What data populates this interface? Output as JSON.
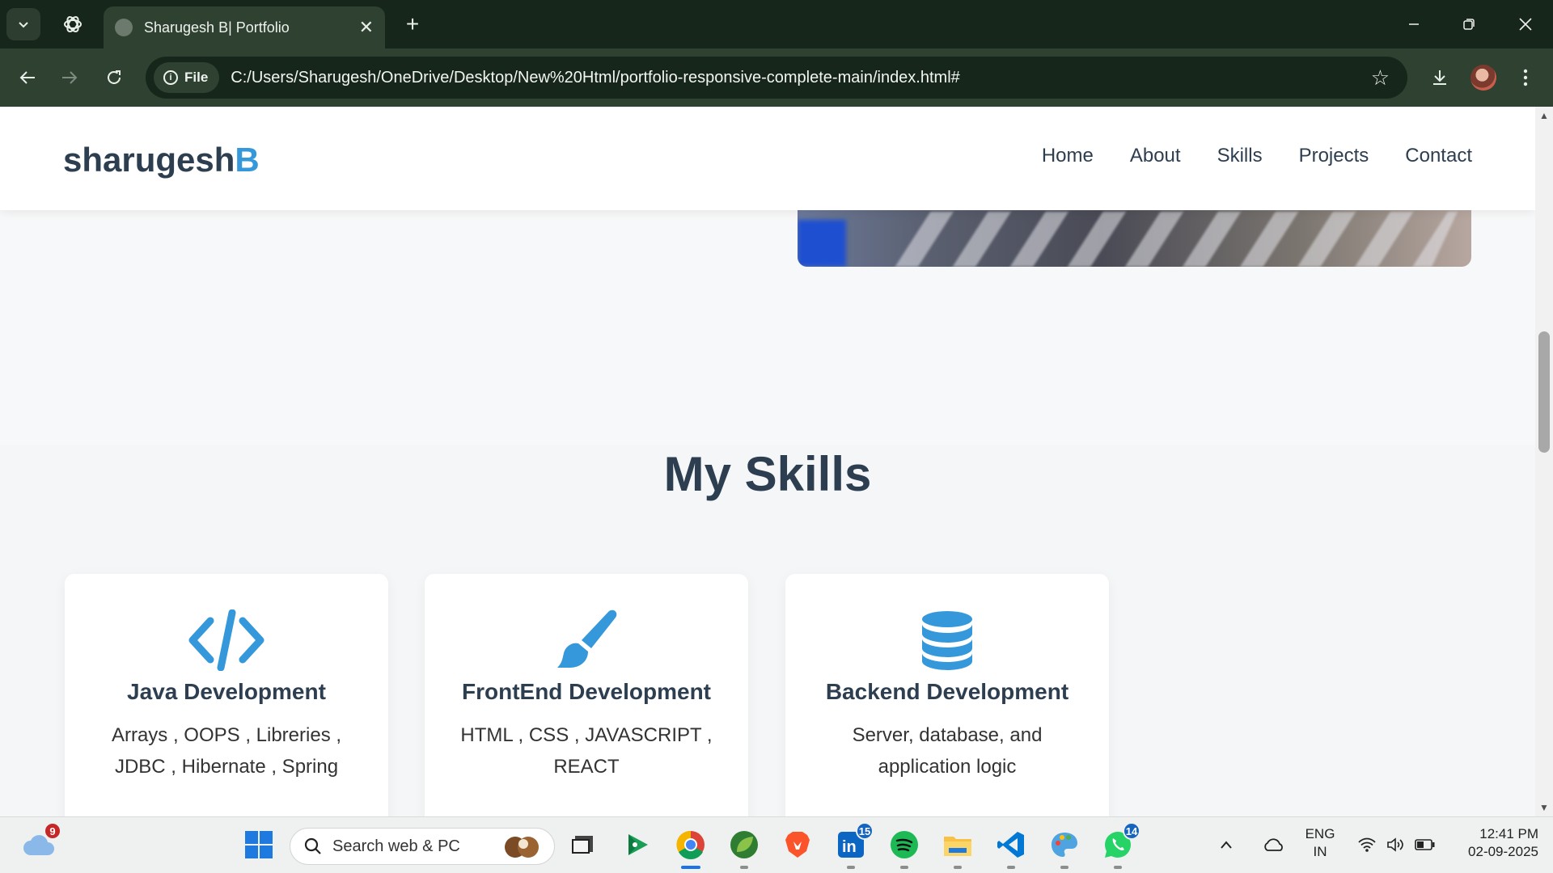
{
  "browser": {
    "tab_title": "Sharugesh B| Portfolio",
    "file_chip": "File",
    "url": "C:/Users/Sharugesh/OneDrive/Desktop/New%20Html/portfolio-responsive-complete-main/index.html#"
  },
  "site": {
    "logo_main": "sharugesh",
    "logo_accent": "B",
    "nav": [
      "Home",
      "About",
      "Skills",
      "Projects",
      "Contact"
    ],
    "section_title": "My Skills",
    "accent_color": "#3498db",
    "text_color": "#2c3e50",
    "skills": [
      {
        "icon": "code-icon",
        "title": "Java Development",
        "desc": "Arrays , OOPS , Libreries , JDBC , Hibernate , Spring"
      },
      {
        "icon": "paint-brush-icon",
        "title": "FrontEnd Development",
        "desc": "HTML , CSS , JAVASCRIPT , REACT"
      },
      {
        "icon": "database-icon",
        "title": "Backend Development",
        "desc": "Server, database, and application logic"
      }
    ]
  },
  "taskbar": {
    "weather_badge": "9",
    "search_placeholder": "Search web & PC",
    "linkedin_badge": "15",
    "whatsapp_badge": "14",
    "lang": "ENG",
    "region": "IN",
    "time": "12:41 PM",
    "date": "02-09-2025"
  }
}
